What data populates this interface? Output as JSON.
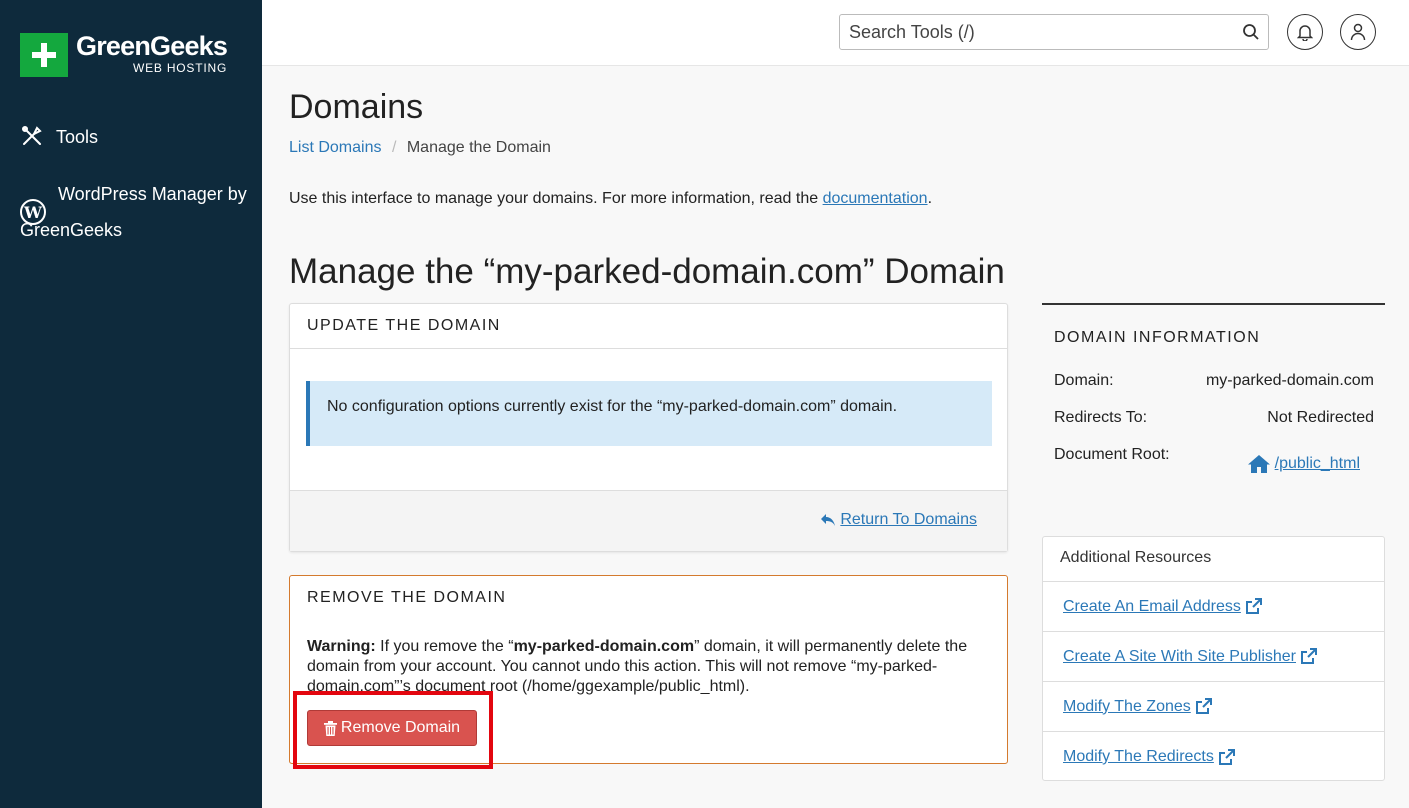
{
  "brand": {
    "name": "GreenGeeks",
    "sub": "WEB HOSTING",
    "accent": "#14a83e"
  },
  "sidebar": {
    "items": [
      {
        "label": "Tools",
        "icon": "tools-icon"
      },
      {
        "label": "WordPress Manager by GreenGeeks",
        "icon": "wordpress-icon"
      }
    ]
  },
  "header": {
    "search_placeholder": "Search Tools (/)"
  },
  "page": {
    "title": "Domains",
    "breadcrumb": {
      "parent": "List Domains",
      "current": "Manage the Domain"
    },
    "intro_text": "Use this interface to manage your domains. For more information, read the ",
    "intro_link": "documentation",
    "intro_end": ".",
    "section_title": "Manage the “my-parked-domain.com” Domain"
  },
  "update_panel": {
    "heading": "UPDATE THE DOMAIN",
    "alert": "No configuration options currently exist for the “my-parked-domain.com” domain.",
    "return_link": "Return To Domains"
  },
  "remove_panel": {
    "heading": "REMOVE THE DOMAIN",
    "warning_label": "Warning:",
    "warning_pre": " If you remove the “",
    "warning_domain": "my-parked-domain.com",
    "warning_post": "” domain, it will permanently delete the domain from your account. You cannot undo this action. This will not remove “my-parked-domain.com”’s document root (/home/ggexample/public_html).",
    "button": "Remove Domain"
  },
  "domain_info": {
    "heading": "DOMAIN INFORMATION",
    "rows": [
      {
        "label": "Domain:",
        "value": "my-parked-domain.com"
      },
      {
        "label": "Redirects To:",
        "value": "Not Redirected"
      },
      {
        "label": "Document Root:",
        "value": "/public_html"
      }
    ]
  },
  "resources": {
    "heading": "Additional Resources",
    "items": [
      "Create An Email Address",
      "Create A Site With Site Publisher",
      "Modify The Zones",
      "Modify The Redirects"
    ]
  },
  "colors": {
    "link": "#2b78b7",
    "sidebar": "#0e2a3c",
    "danger": "#d9534f",
    "highlight": "#e3060f"
  }
}
